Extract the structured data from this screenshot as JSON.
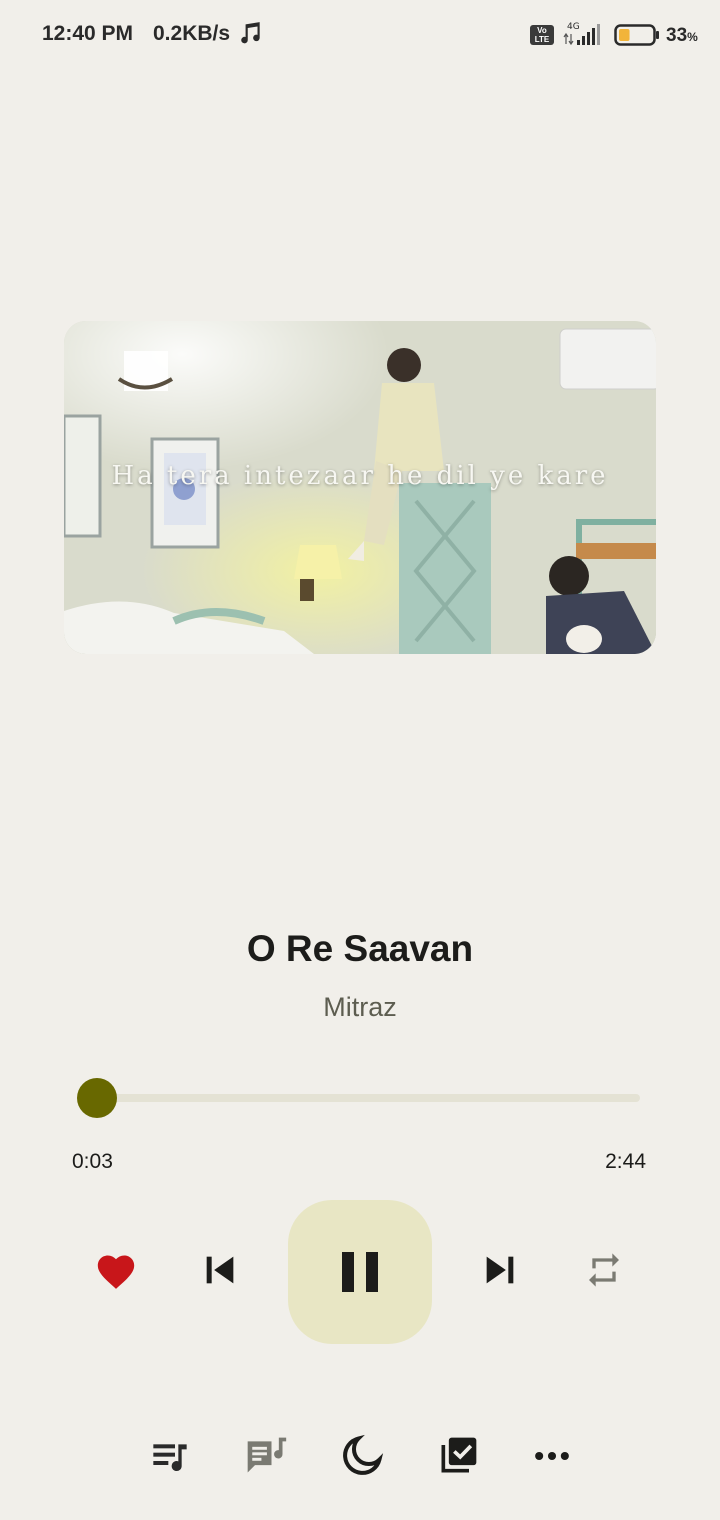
{
  "status_bar": {
    "time": "12:40 PM",
    "speed": "0.2KB/s",
    "volte": "Vo LTE",
    "network": "4G",
    "battery_percent": "33",
    "battery_symbol": "%",
    "battery_level": 0.33
  },
  "artwork": {
    "lyric": "Ha tera intezaar he dil ye kare"
  },
  "track": {
    "title": "O Re Saavan",
    "artist": "Mitraz"
  },
  "progress": {
    "elapsed": "0:03",
    "total": "2:44",
    "fraction": 0.018
  },
  "controls": {
    "liked": true,
    "playing": true
  },
  "colors": {
    "background": "#f1efea",
    "accent": "#686800",
    "play_button_bg": "#e8e6c4",
    "like": "#c8161a"
  },
  "icons": {
    "like": "heart-icon",
    "previous": "skip-previous-icon",
    "play_pause": "pause-icon",
    "next": "skip-next-icon",
    "repeat": "repeat-icon",
    "queue": "queue-music-icon",
    "lyrics": "lyrics-icon",
    "sleep": "moon-icon",
    "save": "library-add-check-icon",
    "more": "more-horiz-icon"
  }
}
